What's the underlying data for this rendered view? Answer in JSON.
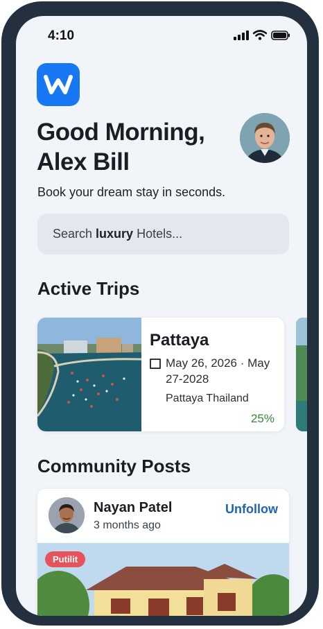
{
  "status_bar": {
    "time": "4:10"
  },
  "app": {
    "logo_letter": "W",
    "brand_color": "#1877f2"
  },
  "header": {
    "greeting_line1": "Good Morning,",
    "greeting_line2": "Alex Bill",
    "tagline": "Book your dream stay in seconds."
  },
  "search": {
    "prefix": "Search ",
    "bold": "luxury",
    "suffix": " Hotels..."
  },
  "active_trips": {
    "title": "Active Trips",
    "trips": [
      {
        "name": "Pattaya",
        "dates": "May 26, 2026 · May 27-2028",
        "location": "Pattaya Thailand",
        "progress": "25%"
      }
    ]
  },
  "community": {
    "title": "Community Posts",
    "posts": [
      {
        "author": "Nayan Patel",
        "time_ago": "3 months ago",
        "action": "Unfollow",
        "badge": "Putilit"
      }
    ]
  },
  "colors": {
    "progress": "#2e8b3a",
    "link": "#1e63b0",
    "badge": "#e5535b",
    "frame": "#22303f",
    "screen_bg": "#f1f4f8"
  }
}
